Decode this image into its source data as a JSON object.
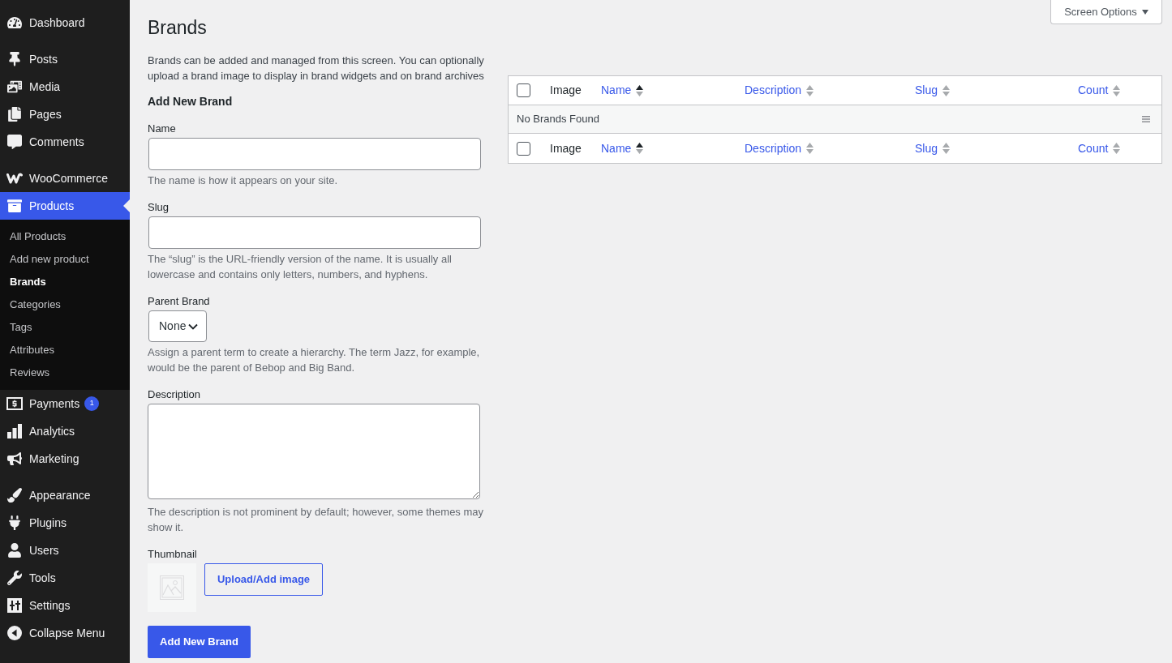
{
  "sidebar": {
    "sections": [
      {
        "items": [
          {
            "label": "Dashboard",
            "selected": false
          }
        ]
      },
      {
        "items": [
          {
            "label": "Posts",
            "selected": false
          },
          {
            "label": "Media",
            "selected": false
          },
          {
            "label": "Pages",
            "selected": false
          },
          {
            "label": "Comments",
            "selected": false
          }
        ]
      },
      {
        "items": [
          {
            "label": "WooCommerce",
            "selected": false
          },
          {
            "label": "Products",
            "selected": true,
            "children": [
              {
                "label": "All Products",
                "selected": false
              },
              {
                "label": "Add new product",
                "selected": false
              },
              {
                "label": "Brands",
                "selected": true
              },
              {
                "label": "Categories",
                "selected": false
              },
              {
                "label": "Tags",
                "selected": false
              },
              {
                "label": "Attributes",
                "selected": false
              },
              {
                "label": "Reviews",
                "selected": false
              }
            ]
          },
          {
            "label": "Payments",
            "selected": false,
            "badge": "1"
          },
          {
            "label": "Analytics",
            "selected": false
          },
          {
            "label": "Marketing",
            "selected": false
          }
        ]
      },
      {
        "items": [
          {
            "label": "Appearance",
            "selected": false
          },
          {
            "label": "Plugins",
            "selected": false
          },
          {
            "label": "Users",
            "selected": false
          },
          {
            "label": "Tools",
            "selected": false
          },
          {
            "label": "Settings",
            "selected": false
          }
        ]
      }
    ],
    "collapse_button": {
      "label": "Collapse Menu"
    }
  },
  "screen_options": {
    "label": "Screen Options"
  },
  "page": {
    "title": "Brands",
    "intro": "Brands can be added and managed from this screen. You can optionally upload a brand image to display in brand widgets and on brand archives"
  },
  "form": {
    "heading": "Add New Brand",
    "fields": [
      {
        "kind": "input",
        "label": "Name",
        "hint": "The name is how it appears on your site."
      },
      {
        "kind": "input",
        "label": "Slug",
        "hint": "The “slug” is the URL-friendly version of the name. It is usually all lowercase and contains only letters, numbers, and hyphens."
      },
      {
        "kind": "select",
        "label": "Parent Brand",
        "value": "None",
        "hint": "Assign a parent term to create a hierarchy. The term Jazz, for example, would be the parent of Bebop and Big Band."
      },
      {
        "kind": "textarea",
        "label": "Description",
        "hint": "The description is not prominent by default; however, some themes may show it."
      },
      {
        "kind": "image",
        "label": "Thumbnail",
        "button": "Upload/Add image"
      }
    ],
    "submit": "Add New Brand"
  },
  "table": {
    "header": {
      "checked": false,
      "columns": [
        {
          "kind": "plain",
          "label": "Image"
        },
        {
          "kind": "sortable",
          "label": "Name",
          "sorted": true
        },
        {
          "kind": "sortable",
          "label": "Description",
          "sorted": false
        },
        {
          "kind": "sortable",
          "label": "Slug",
          "sorted": false
        },
        {
          "kind": "sortable",
          "label": "Count",
          "sorted": false
        }
      ]
    },
    "empty_row": {
      "message": "No Brands Found"
    },
    "footer": {
      "checked": false,
      "columns": [
        {
          "kind": "plain",
          "label": "Image"
        },
        {
          "kind": "sortable",
          "label": "Name",
          "sorted": true
        },
        {
          "kind": "sortable",
          "label": "Description",
          "sorted": false
        },
        {
          "kind": "sortable",
          "label": "Slug",
          "sorted": false
        },
        {
          "kind": "sortable",
          "label": "Count",
          "sorted": false
        }
      ]
    }
  }
}
